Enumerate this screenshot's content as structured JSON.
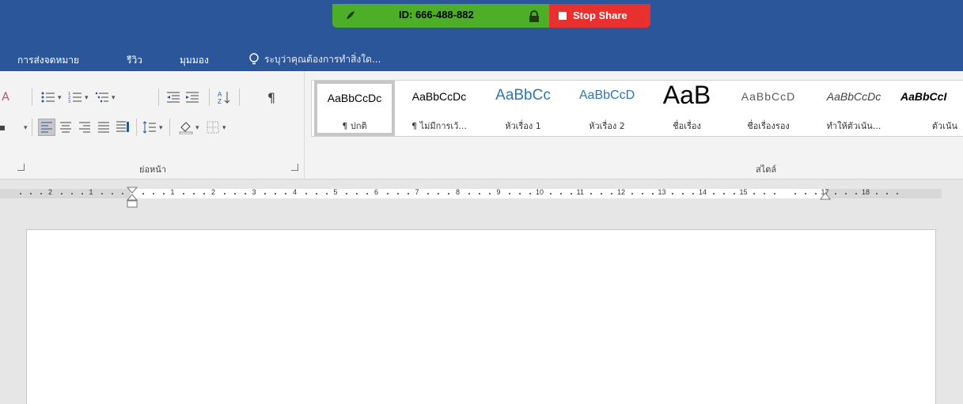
{
  "share": {
    "meeting_id": "ID: 666-488-882",
    "stop_label": "Stop Share",
    "green": "#4caf27",
    "red": "#e8302f"
  },
  "tabs": [
    {
      "label": "การส่งจดหมาย"
    },
    {
      "label": "รีวิว"
    },
    {
      "label": "มุมมอง"
    }
  ],
  "tell_me": {
    "placeholder": "ระบุว่าคุณต้องการทำสิ่งใด..."
  },
  "ribbon": {
    "paragraph_group_label": "ย่อหน้า",
    "styles_group_label": "สไตล์",
    "styles": [
      {
        "preview": "AaBbCcDc",
        "name": "¶ ปกติ"
      },
      {
        "preview": "AaBbCcDc",
        "name": "¶ ไม่มีการเว้..."
      },
      {
        "preview": "AaBbCc",
        "name": "หัวเรื่อง 1"
      },
      {
        "preview": "AaBbCcD",
        "name": "หัวเรื่อง 2"
      },
      {
        "preview": "AaB",
        "name": "ชื่อเรื่อง"
      },
      {
        "preview": "AaBbCcD",
        "name": "ชื่อเรื่องรอง"
      },
      {
        "preview": "AaBbCcDc",
        "name": "ทำให้ตัวเน้น..."
      },
      {
        "preview": "AaBbCcI",
        "name": "ตัวเน้น"
      }
    ]
  },
  "ruler": {
    "left_numbers": [
      "2",
      "1"
    ],
    "right_numbers": [
      "1",
      "2",
      "3",
      "4",
      "5",
      "6",
      "7",
      "8",
      "9",
      "10",
      "11",
      "12",
      "13",
      "14",
      "15"
    ],
    "margin_numbers": [
      "17",
      "18"
    ]
  },
  "colors": {
    "titlebar": "#2b579a"
  }
}
